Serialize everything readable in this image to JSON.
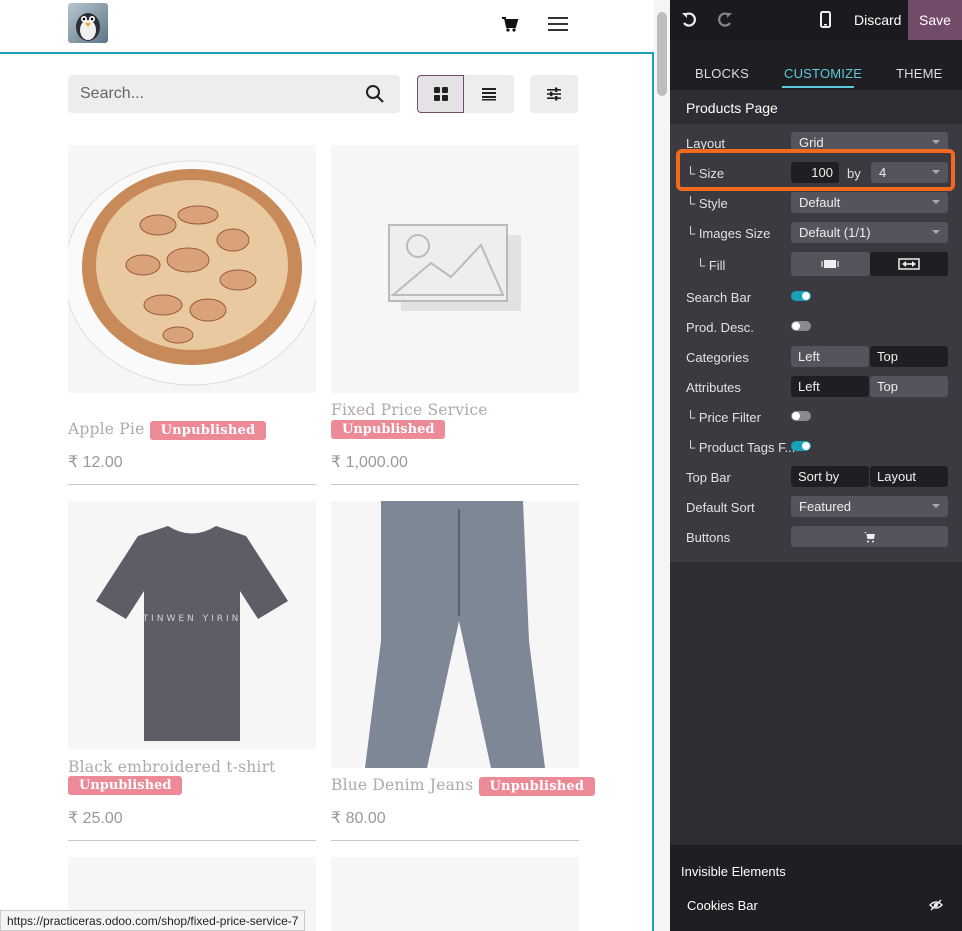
{
  "header": {
    "cart_icon": "cart-icon",
    "menu_icon": "hamburger-icon"
  },
  "search": {
    "placeholder": "Search..."
  },
  "view": {
    "grid_icon": "grid-icon",
    "list_icon": "list-icon",
    "filter_icon": "sliders-icon"
  },
  "products": [
    {
      "name": "Apple Pie",
      "badge": "Unpublished",
      "price": "₹ 12.00"
    },
    {
      "name": "Fixed Price Service",
      "badge": "Unpublished",
      "price": "₹ 1,000.00"
    },
    {
      "name": "Black embroidered t-shirt",
      "badge": "Unpublished",
      "price": "₹ 25.00"
    },
    {
      "name": "Blue Denim Jeans",
      "badge": "Unpublished",
      "price": "₹ 80.00"
    }
  ],
  "status_url": "https://practiceras.odoo.com/shop/fixed-price-service-7",
  "editor": {
    "discard": "Discard",
    "save": "Save",
    "tabs": [
      "BLOCKS",
      "CUSTOMIZE",
      "THEME"
    ],
    "section_title": "Products Page",
    "layout_label": "Layout",
    "layout_value": "Grid",
    "size_label": "└ Size",
    "size_value": "100",
    "size_by": "by",
    "size_cols": "4",
    "style_label": "└ Style",
    "style_value": "Default",
    "images_label": "└ Images Size",
    "images_value": "Default (1/1)",
    "fill_label": "└ Fill",
    "searchbar_label": "Search Bar",
    "proddesc_label": "Prod. Desc.",
    "categories_label": "Categories",
    "categories_left": "Left",
    "categories_top": "Top",
    "attributes_label": "Attributes",
    "attributes_left": "Left",
    "attributes_top": "Top",
    "pricefilter_label": "└ Price Filter",
    "prodtags_label": "└ Product Tags F...",
    "topbar_label": "Top Bar",
    "topbar_sort": "Sort by",
    "topbar_layout": "Layout",
    "defaultsort_label": "Default Sort",
    "defaultsort_value": "Featured",
    "buttons_label": "Buttons",
    "invisible_title": "Invisible Elements",
    "cookies_bar": "Cookies Bar"
  },
  "colors": {
    "accent": "#714b67",
    "teal": "#17a2b8",
    "badge": "#ec8a98",
    "highlight": "#f36a1f"
  }
}
